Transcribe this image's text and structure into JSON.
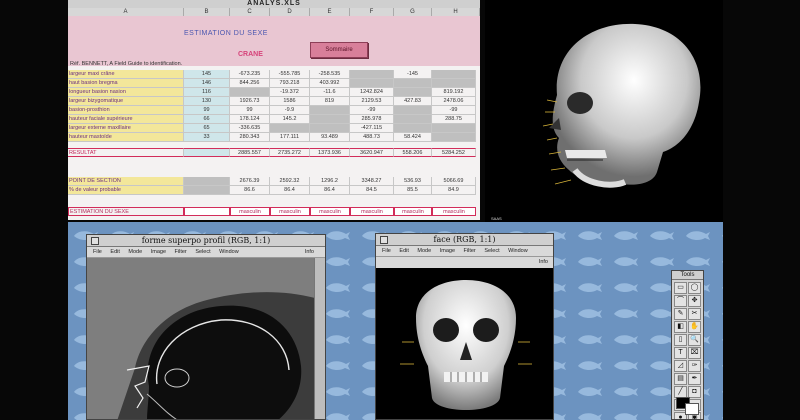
{
  "spreadsheet": {
    "title": "ANALYS.XLS",
    "columns": [
      "A",
      "B",
      "C",
      "D",
      "E",
      "F",
      "G",
      "H"
    ],
    "header": "ESTIMATION DU SEXE",
    "subheader": "CRANE",
    "sommaire_button": "Sommaire",
    "source": "Réf. BENNETT, A Field Guide to identification.",
    "rows": [
      {
        "label": "largeur maxi crâne",
        "b": "145",
        "c": "-673.235",
        "d": "-555.785",
        "e": "-258.535",
        "f": "",
        "g": "-145",
        "h": ""
      },
      {
        "label": "haut basion bregma",
        "b": "146",
        "c": "844.256",
        "d": "793.218",
        "e": "403.992",
        "f": "",
        "g": "",
        "h": ""
      },
      {
        "label": "longueur basion nasion",
        "b": "116",
        "c": "",
        "d": "-19.372",
        "e": "-11.6",
        "f": "1242.824",
        "g": "",
        "h": "819.192"
      },
      {
        "label": "largeur bizygomatique",
        "b": "130",
        "c": "1926.73",
        "d": "1586",
        "e": "819",
        "f": "2129.53",
        "g": "427.83",
        "h": "2478.06"
      },
      {
        "label": "basion-prosthion",
        "b": "99",
        "c": "99",
        "d": "-9.9",
        "e": "",
        "f": "-99",
        "g": "",
        "h": "-99"
      },
      {
        "label": "hauteur faciale supérieure",
        "b": "66",
        "c": "178.124",
        "d": "145.2",
        "e": "",
        "f": "285.978",
        "g": "",
        "h": "288.75"
      },
      {
        "label": "largeur externe maxillaire",
        "b": "65",
        "c": "-336.635",
        "d": "",
        "e": "",
        "f": "-427.115",
        "g": "",
        "h": ""
      },
      {
        "label": "hauteur mastoïde",
        "b": "33",
        "c": "280.343",
        "d": "177.111",
        "e": "93.489",
        "f": "488.73",
        "g": "58.424",
        "h": ""
      }
    ],
    "result": {
      "label": "RESULTAT",
      "b": "",
      "c": "2885.557",
      "d": "2735.272",
      "e": "1373.936",
      "f": "3620.947",
      "g": "558.206",
      "h": "5284.252"
    },
    "section": {
      "label": "POINT DE SECTION",
      "b": "",
      "c": "2676.39",
      "d": "2592.32",
      "e": "1296.2",
      "f": "3348.27",
      "g": "536.93",
      "h": "5066.69"
    },
    "probable": {
      "label": "% de valeur probable",
      "b": "",
      "c": "86.6",
      "d": "86.4",
      "e": "86.4",
      "f": "84.5",
      "g": "85.5",
      "h": "84.9"
    },
    "sex_estimate": {
      "label": "ESTIMATION DU SEXE",
      "b": "",
      "c": "masculin",
      "d": "masculin",
      "e": "masculin",
      "f": "masculin",
      "g": "masculin",
      "h": "masculin"
    }
  },
  "skull_viewer": {
    "label": "SAAS"
  },
  "profile_window": {
    "title": "forme superpo profil  (RGB, 1:1)",
    "menu": [
      "File",
      "Edit",
      "Mode",
      "Image",
      "Filter",
      "Select",
      "Window"
    ],
    "info": "Info"
  },
  "face_window": {
    "title": "face  (RGB, 1:1)",
    "menu": [
      "File",
      "Edit",
      "Mode",
      "Image",
      "Filter",
      "Select",
      "Window"
    ],
    "info": "Info"
  },
  "tools_palette": {
    "title": "Tools",
    "tools": [
      "▭",
      "◯",
      "⌒",
      "✥",
      "✎",
      "✂",
      "◧",
      "✋",
      "▯",
      "🔍",
      "T",
      "⌧",
      "◿",
      "✑",
      "▤",
      "✒",
      "╱",
      "◘",
      "◐",
      "◒",
      "●",
      "◉"
    ]
  },
  "colors": {
    "desktop": "#6c93c0",
    "accent_pink": "#d22c5a",
    "label_yellow": "#f3e79a",
    "value_cyan": "#cfe6ea"
  }
}
